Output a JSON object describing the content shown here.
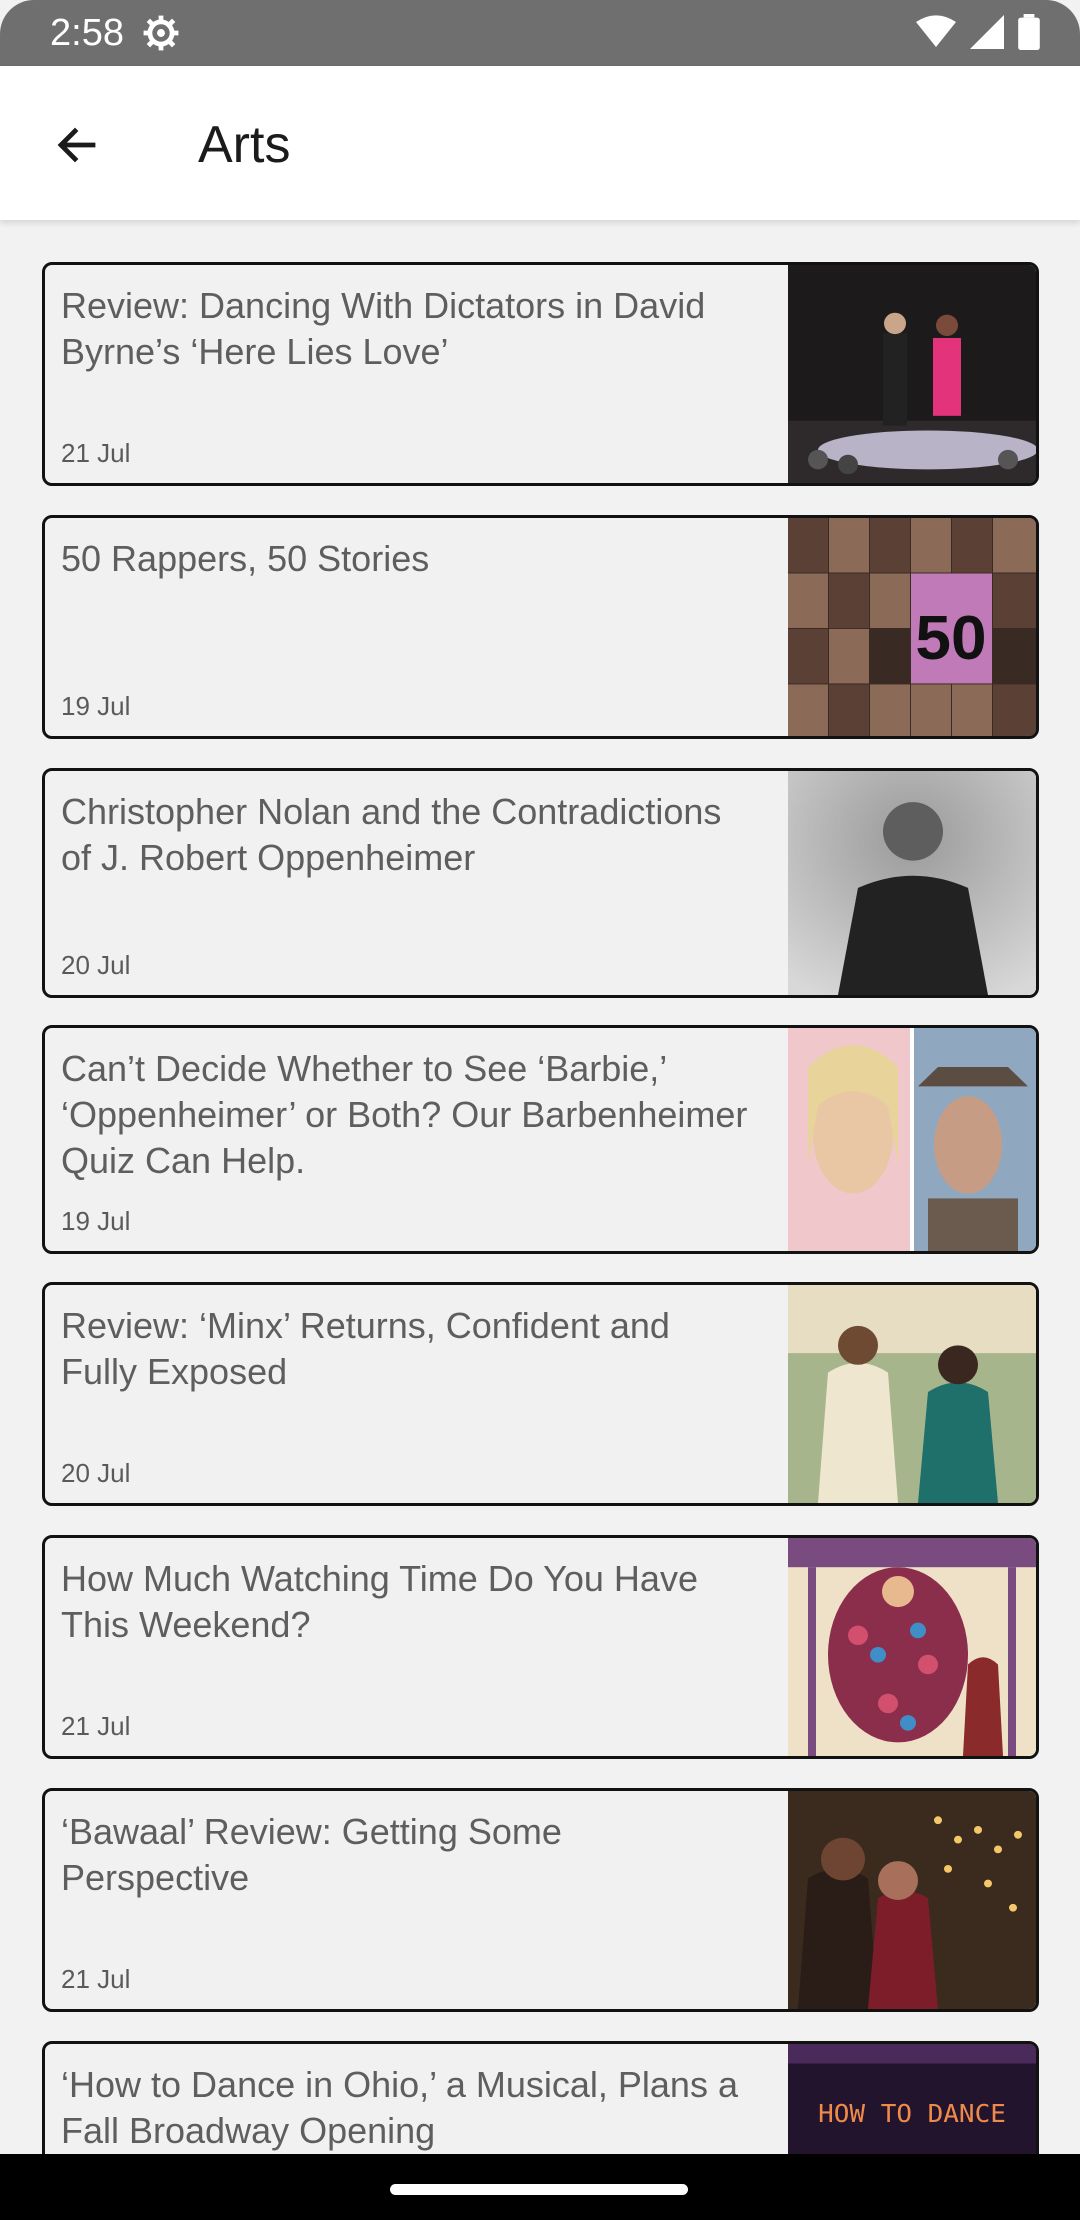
{
  "status": {
    "time": "2:58"
  },
  "header": {
    "title": "Arts"
  },
  "articles": [
    {
      "title": "Review: Dancing With Dictators in David Byrne’s ‘Here Lies Love’",
      "date": "21 Jul"
    },
    {
      "title": "50 Rappers, 50 Stories",
      "date": "19 Jul",
      "thumb_text": "50"
    },
    {
      "title": "Christopher Nolan and the Contradictions of J. Robert Oppenheimer",
      "date": "20 Jul"
    },
    {
      "title": "Can’t Decide Whether to See ‘Barbie,’ ‘Oppenheimer’ or Both? Our Barbenheimer Quiz Can Help.",
      "date": "19 Jul"
    },
    {
      "title": "Review: ‘Minx’ Returns, Confident and Fully Exposed",
      "date": "20 Jul"
    },
    {
      "title": "How Much Watching Time Do You Have This Weekend?",
      "date": "21 Jul"
    },
    {
      "title": "‘Bawaal’ Review: Getting Some Perspective",
      "date": "21 Jul"
    },
    {
      "title": "‘How to Dance in Ohio,’ a Musical, Plans a Fall Broadway Opening",
      "date": "",
      "thumb_text": "HOW TO DANCE"
    }
  ]
}
